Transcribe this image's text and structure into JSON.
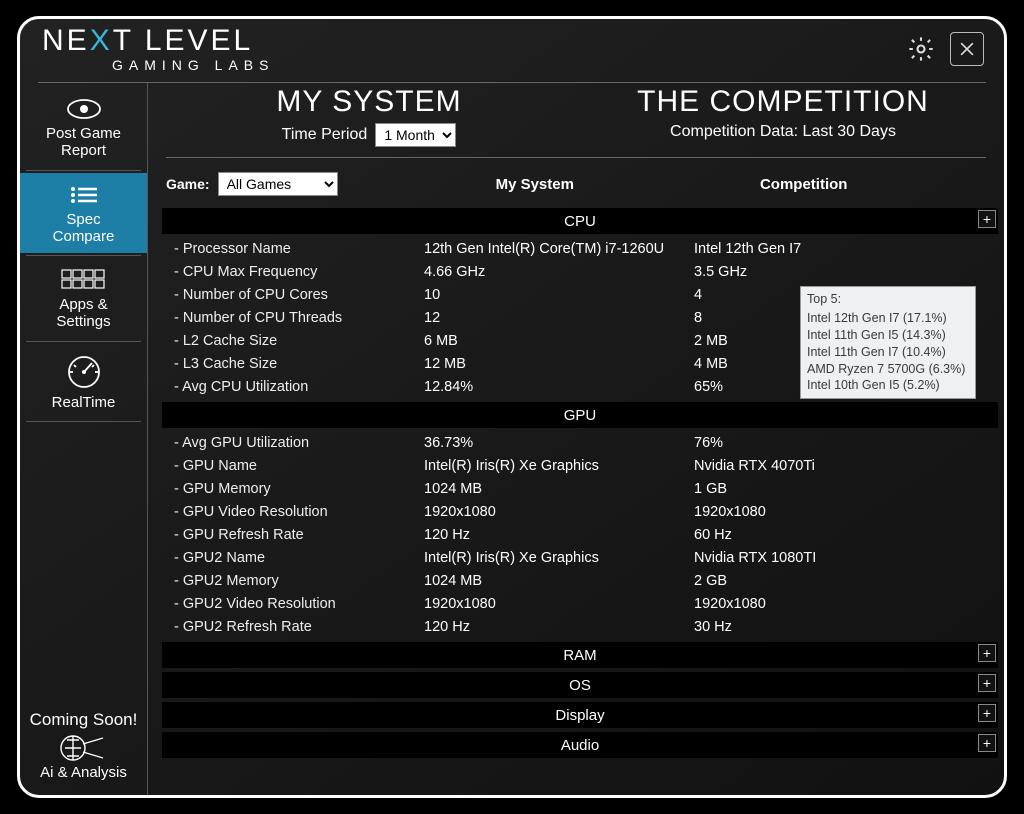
{
  "brand": {
    "line1_left": "NE",
    "line1_x": "X",
    "line1_right": "T LEVEL",
    "line2": "GAMING LABS"
  },
  "sidebar": {
    "items": [
      {
        "l1": "Post Game",
        "l2": "Report"
      },
      {
        "l1": "Spec",
        "l2": "Compare"
      },
      {
        "l1": "Apps &",
        "l2": "Settings"
      },
      {
        "l1": "RealTime",
        "l2": ""
      }
    ],
    "coming_soon": "Coming Soon!",
    "ai": "Ai & Analysis"
  },
  "header": {
    "mine_title": "MY SYSTEM",
    "comp_title": "THE COMPETITION",
    "time_label": "Time Period",
    "time_value": "1 Month",
    "comp_sub": "Competition Data: Last 30 Days"
  },
  "filter": {
    "game_label": "Game:",
    "game_value": "All Games",
    "mine_col": "My System",
    "comp_col": "Competition"
  },
  "sections": [
    {
      "title": "CPU",
      "expand": "+",
      "expanded": true,
      "rows": [
        {
          "name": "Processor Name",
          "mine": "12th Gen Intel(R) Core(TM) i7-1260U",
          "comp": "Intel 12th Gen I7"
        },
        {
          "name": "CPU Max Frequency",
          "mine": "4.66 GHz",
          "comp": "3.5 GHz"
        },
        {
          "name": "Number of CPU Cores",
          "mine": "10",
          "comp": "4"
        },
        {
          "name": "Number of CPU Threads",
          "mine": "12",
          "comp": "8"
        },
        {
          "name": "L2 Cache Size",
          "mine": "6 MB",
          "comp": "2 MB"
        },
        {
          "name": "L3 Cache Size",
          "mine": "12 MB",
          "comp": "4 MB"
        },
        {
          "name": "Avg CPU Utilization",
          "mine": "12.84%",
          "comp": "65%"
        }
      ]
    },
    {
      "title": "GPU",
      "expanded": true,
      "rows": [
        {
          "name": "Avg GPU Utilization",
          "mine": "36.73%",
          "comp": "76%"
        },
        {
          "name": "GPU Name",
          "mine": "Intel(R) Iris(R) Xe Graphics",
          "comp": "Nvidia RTX 4070Ti"
        },
        {
          "name": "GPU Memory",
          "mine": "1024 MB",
          "comp": "1 GB"
        },
        {
          "name": "GPU Video Resolution",
          "mine": "1920x1080",
          "comp": "1920x1080"
        },
        {
          "name": "GPU Refresh Rate",
          "mine": "120 Hz",
          "comp": "60 Hz"
        },
        {
          "name": "GPU2 Name",
          "mine": "Intel(R) Iris(R) Xe Graphics",
          "comp": "Nvidia RTX 1080TI"
        },
        {
          "name": "GPU2 Memory",
          "mine": "1024 MB",
          "comp": "2 GB"
        },
        {
          "name": "GPU2 Video Resolution",
          "mine": "1920x1080",
          "comp": "1920x1080"
        },
        {
          "name": "GPU2 Refresh Rate",
          "mine": "120 Hz",
          "comp": "30 Hz"
        }
      ]
    },
    {
      "title": "RAM",
      "expand": "+",
      "expanded": false,
      "rows": []
    },
    {
      "title": "OS",
      "expand": "+",
      "expanded": false,
      "rows": []
    },
    {
      "title": "Display",
      "expand": "+",
      "expanded": false,
      "rows": []
    },
    {
      "title": "Audio",
      "expand": "+",
      "expanded": false,
      "rows": []
    }
  ],
  "tooltip": {
    "title": "Top 5:",
    "items": [
      "Intel 12th Gen I7 (17.1%)",
      "Intel  11th Gen I5 (14.3%)",
      "Intel 11th Gen I7 (10.4%)",
      "AMD Ryzen 7 5700G (6.3%)",
      "Intel 10th Gen I5 (5.2%)"
    ]
  }
}
